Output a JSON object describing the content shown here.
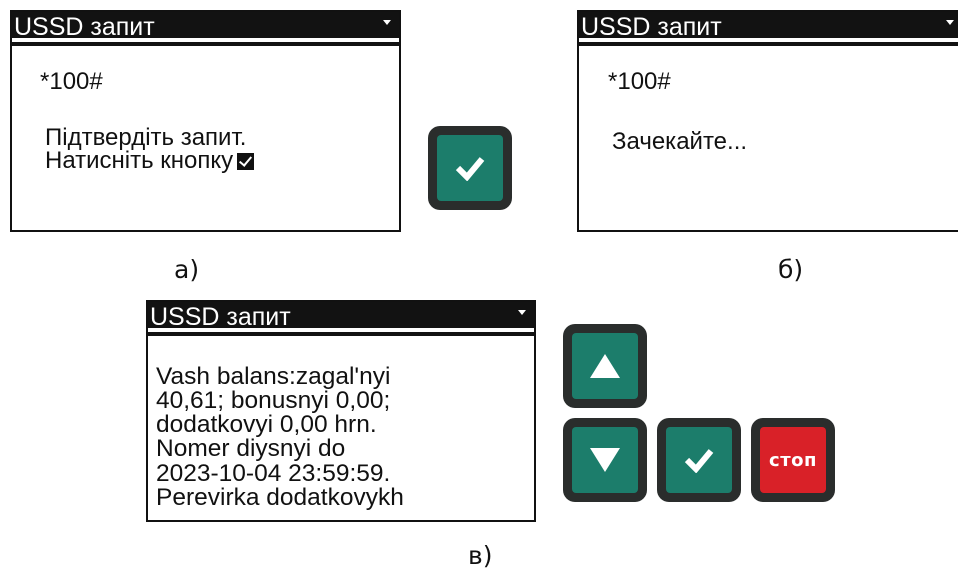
{
  "panel_a": {
    "title": "USSD запит",
    "code_star": "*",
    "code": "100#",
    "line1": "Підтвердіть запит.",
    "line2": "Натисніть кнопку",
    "caption": "а)"
  },
  "panel_b": {
    "title": "USSD запит",
    "code_star": "*",
    "code": "100#",
    "line1": "Зачекайте...",
    "caption": "б)"
  },
  "panel_c": {
    "title": "USSD запит",
    "lines": [
      "Vash balans:zagal'nyi",
      "40,61; bonusnyi 0,00;",
      "dodatkovyi 0,00 hrn.",
      "Nomer diysnyi do",
      "2023-10-04 23:59:59.",
      "Perevirka dodatkovykh"
    ],
    "caption": "в)"
  },
  "keys": {
    "stop_label": "стоп",
    "colors": {
      "green": "#1c7d6b",
      "red": "#d92128",
      "bezel": "#2a2d2c"
    },
    "icons": [
      "confirm-check-icon",
      "arrow-up-icon",
      "arrow-down-icon"
    ]
  }
}
